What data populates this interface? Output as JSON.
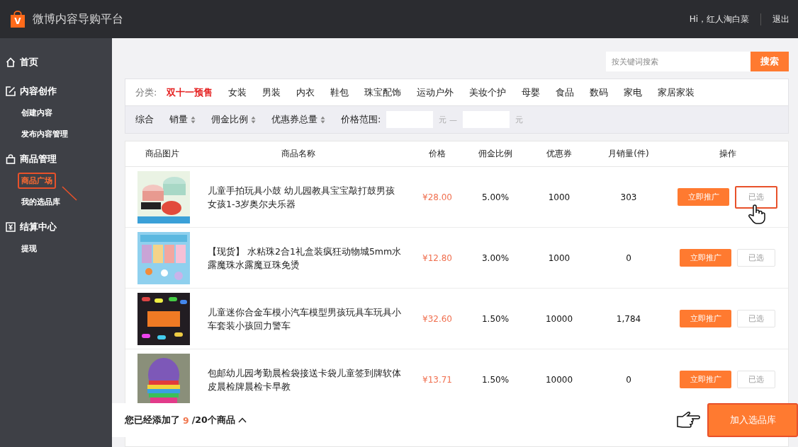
{
  "header": {
    "logo_mark": "V",
    "title": "微博内容导购平台",
    "greeting": "Hi，红人淘白菜",
    "logout": "退出"
  },
  "sidebar": [
    {
      "kind": "home",
      "label": "首页"
    },
    {
      "kind": "edit",
      "label": "内容创作",
      "children": [
        {
          "label": "创建内容",
          "selected": false,
          "highlighted": false
        },
        {
          "label": "发布内容管理",
          "selected": false,
          "highlighted": false
        }
      ]
    },
    {
      "kind": "bag",
      "label": "商品管理",
      "children": [
        {
          "label": "商品广场",
          "selected": true,
          "highlighted": true
        },
        {
          "label": "我的选品库",
          "selected": false,
          "highlighted": false
        }
      ]
    },
    {
      "kind": "money",
      "label": "结算中心",
      "children": [
        {
          "label": "提现",
          "selected": false,
          "highlighted": false
        }
      ]
    }
  ],
  "search": {
    "placeholder": "按关键词搜索",
    "button": "搜索"
  },
  "categories": {
    "label": "分类:",
    "items": [
      {
        "label": "双十一预售",
        "selected": true
      },
      {
        "label": "女装",
        "selected": false
      },
      {
        "label": "男装",
        "selected": false
      },
      {
        "label": "内衣",
        "selected": false
      },
      {
        "label": "鞋包",
        "selected": false
      },
      {
        "label": "珠宝配饰",
        "selected": false
      },
      {
        "label": "运动户外",
        "selected": false
      },
      {
        "label": "美妆个护",
        "selected": false
      },
      {
        "label": "母婴",
        "selected": false
      },
      {
        "label": "食品",
        "selected": false
      },
      {
        "label": "数码",
        "selected": false
      },
      {
        "label": "家电",
        "selected": false
      },
      {
        "label": "家居家装",
        "selected": false
      }
    ]
  },
  "sort": {
    "items": [
      {
        "label": "综合",
        "kind": "plain"
      },
      {
        "label": "销量",
        "kind": "sortable"
      },
      {
        "label": "佣金比例",
        "kind": "sortable"
      },
      {
        "label": "优惠券总量",
        "kind": "sortable"
      }
    ],
    "price_label": "价格范围:",
    "unit_from": "元 —",
    "unit_to": "元"
  },
  "table": {
    "columns": [
      "商品图片",
      "商品名称",
      "价格",
      "佣金比例",
      "优惠券",
      "月销量(件)",
      "操作"
    ],
    "rows": [
      {
        "name": "儿童手拍玩具小鼓 幼儿园教具宝宝敲打鼓男孩女孩1-3岁奥尔夫乐器",
        "price": "¥28.00",
        "commission": "5.00%",
        "coupon": "1000",
        "monthly_sales": "303",
        "promote": "立即推广",
        "pick": "已选",
        "highlighted": true
      },
      {
        "name": "【现货】 水粘珠2合1礼盒装疯狂动物城5mm水露魔珠水露魔豆珠免烫",
        "price": "¥12.80",
        "commission": "3.00%",
        "coupon": "1000",
        "monthly_sales": "0",
        "promote": "立即推广",
        "pick": "已选",
        "highlighted": false
      },
      {
        "name": "儿童迷你合金车模小汽车模型男孩玩具车玩具小车套装小孩回力警车",
        "price": "¥32.60",
        "commission": "1.50%",
        "coupon": "10000",
        "monthly_sales": "1,784",
        "promote": "立即推广",
        "pick": "已选",
        "highlighted": false
      },
      {
        "name": "包邮幼儿园考勤晨检袋接送卡袋儿童签到牌软体皮晨检牌晨检卡早教",
        "price": "¥13.71",
        "commission": "1.50%",
        "coupon": "10000",
        "monthly_sales": "0",
        "promote": "立即推广",
        "pick": "已选",
        "highlighted": false
      }
    ]
  },
  "footer": {
    "prefix": "您已经添加了",
    "count": "9",
    "suffix": "/20个商品",
    "button": "加入选品库",
    "button_highlighted": true
  }
}
